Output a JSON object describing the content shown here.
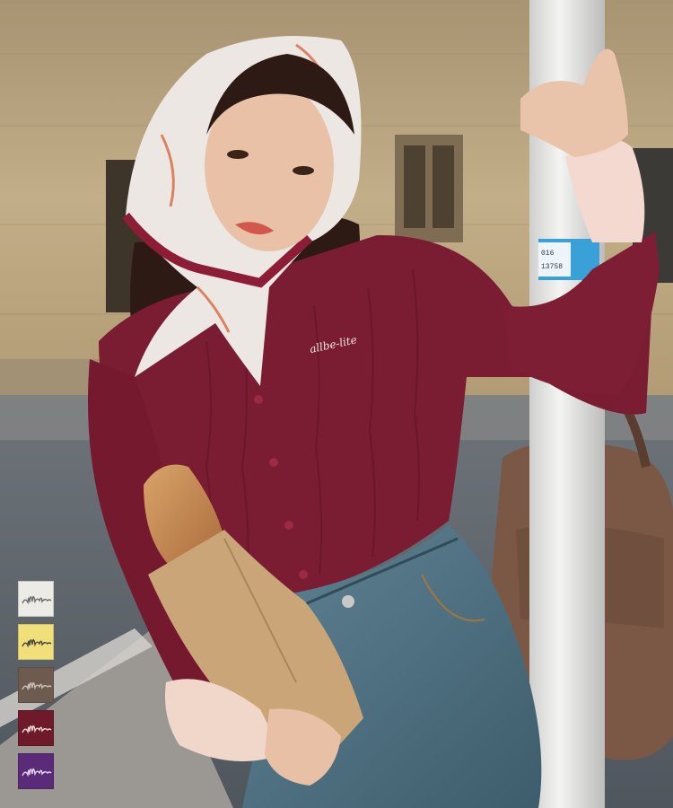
{
  "colors": {
    "wall": "#b9a37e",
    "street": "#5d646b",
    "sweater": "#7a1c32",
    "denim": "#4d6f80",
    "bag": "#7d5a46",
    "pole": "#e8e8e6",
    "label_blue": "#3aa0d8"
  },
  "pole_label": {
    "line1": "016",
    "line2": "13758"
  },
  "chest_embroidery": "allbe-lite",
  "swatches": [
    {
      "name": "white",
      "color": "#ecebe6",
      "stroke": "#6b6b6b"
    },
    {
      "name": "yellow",
      "color": "#f1e07a",
      "stroke": "#444444"
    },
    {
      "name": "brown",
      "color": "#6e5b50",
      "stroke": "#c9bfb7"
    },
    {
      "name": "burgundy",
      "color": "#6f1a2a",
      "stroke": "#e9d8d8"
    },
    {
      "name": "purple",
      "color": "#5a2b78",
      "stroke": "#e4d6ef"
    }
  ]
}
